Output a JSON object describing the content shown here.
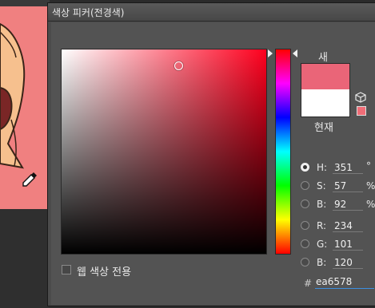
{
  "window": {
    "title": "색상 피커(전경색)"
  },
  "swatches": {
    "new_label": "새",
    "current_label": "현재",
    "new_color": "#ea6578",
    "current_color": "#ffffff",
    "websafe_color": "#f06d77"
  },
  "color_field": {
    "hue_base_color": "#ff001e",
    "picker_saturation": 0.57,
    "picker_brightness": 0.92
  },
  "hue_slider": {
    "hue_degrees": 351
  },
  "hsb": [
    {
      "label": "H:",
      "value": "351",
      "unit": "°",
      "selected": true
    },
    {
      "label": "S:",
      "value": "57",
      "unit": "%",
      "selected": false
    },
    {
      "label": "B:",
      "value": "92",
      "unit": "%",
      "selected": false
    }
  ],
  "rgb": [
    {
      "label": "R:",
      "value": "234"
    },
    {
      "label": "G:",
      "value": "101"
    },
    {
      "label": "B:",
      "value": "120"
    }
  ],
  "hex": {
    "hash": "#",
    "value": "ea6578"
  },
  "web_colors": {
    "label": "웹 색상 전용",
    "checked": false
  },
  "icons": {
    "cube": "cube-icon",
    "dropper": "eyedropper-icon"
  },
  "colors": {
    "dialog_bg": "#535353",
    "canvas_bg": "#f08080",
    "focus_accent": "#3d8fe0"
  }
}
